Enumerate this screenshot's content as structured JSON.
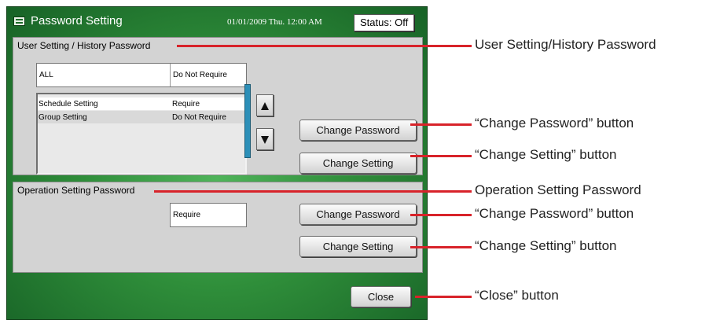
{
  "window": {
    "title": "Password Setting",
    "datetime": "01/01/2009 Thu. 12:00 AM",
    "status": "Status: Off"
  },
  "user_section": {
    "label": "User Setting / History Password",
    "all_row": {
      "name": "ALL",
      "value": "Do Not Require"
    },
    "list": [
      {
        "name": "Schedule Setting",
        "value": "Require"
      },
      {
        "name": "Group Setting",
        "value": "Do Not Require"
      }
    ],
    "change_password": "Change Password",
    "change_setting": "Change Setting"
  },
  "operation_section": {
    "label": "Operation Setting Password",
    "value": "Require",
    "change_password": "Change Password",
    "change_setting": "Change Setting"
  },
  "close_label": "Close",
  "callouts": {
    "user_section": "User Setting/History Password",
    "change_password_1": "“Change Password” button",
    "change_setting_1": "“Change Setting” button",
    "operation_section": "Operation Setting Password",
    "change_password_2": "“Change Password” button",
    "change_setting_2": "“Change Setting” button",
    "close": "“Close” button"
  },
  "colors": {
    "accent_green": "#2f8e3a",
    "callout_line": "#d8232a",
    "scrollbar": "#2c8fb8"
  },
  "icons": [
    "window-icon",
    "arrow-up-icon",
    "arrow-down-icon"
  ]
}
